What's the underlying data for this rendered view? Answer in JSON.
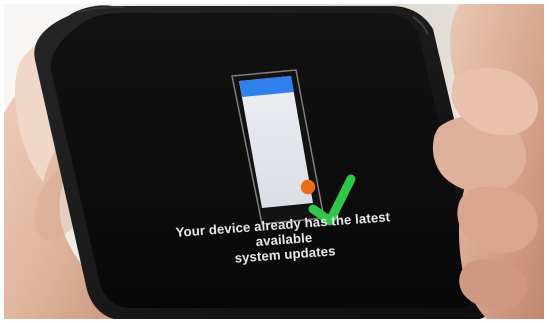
{
  "screen": {
    "message_line1": "Your device already has the latest available",
    "message_line2": "system updates"
  },
  "icons": {
    "device": "phone-illustration-icon",
    "check": "check-icon"
  },
  "colors": {
    "screen_black": "#111111",
    "phone_header_blue": "#2f80ed",
    "phone_screen_light": "#e7e8ec",
    "dot_orange": "#ef6c16",
    "check_green": "#30c64b",
    "text_light": "#e7e7e7"
  }
}
